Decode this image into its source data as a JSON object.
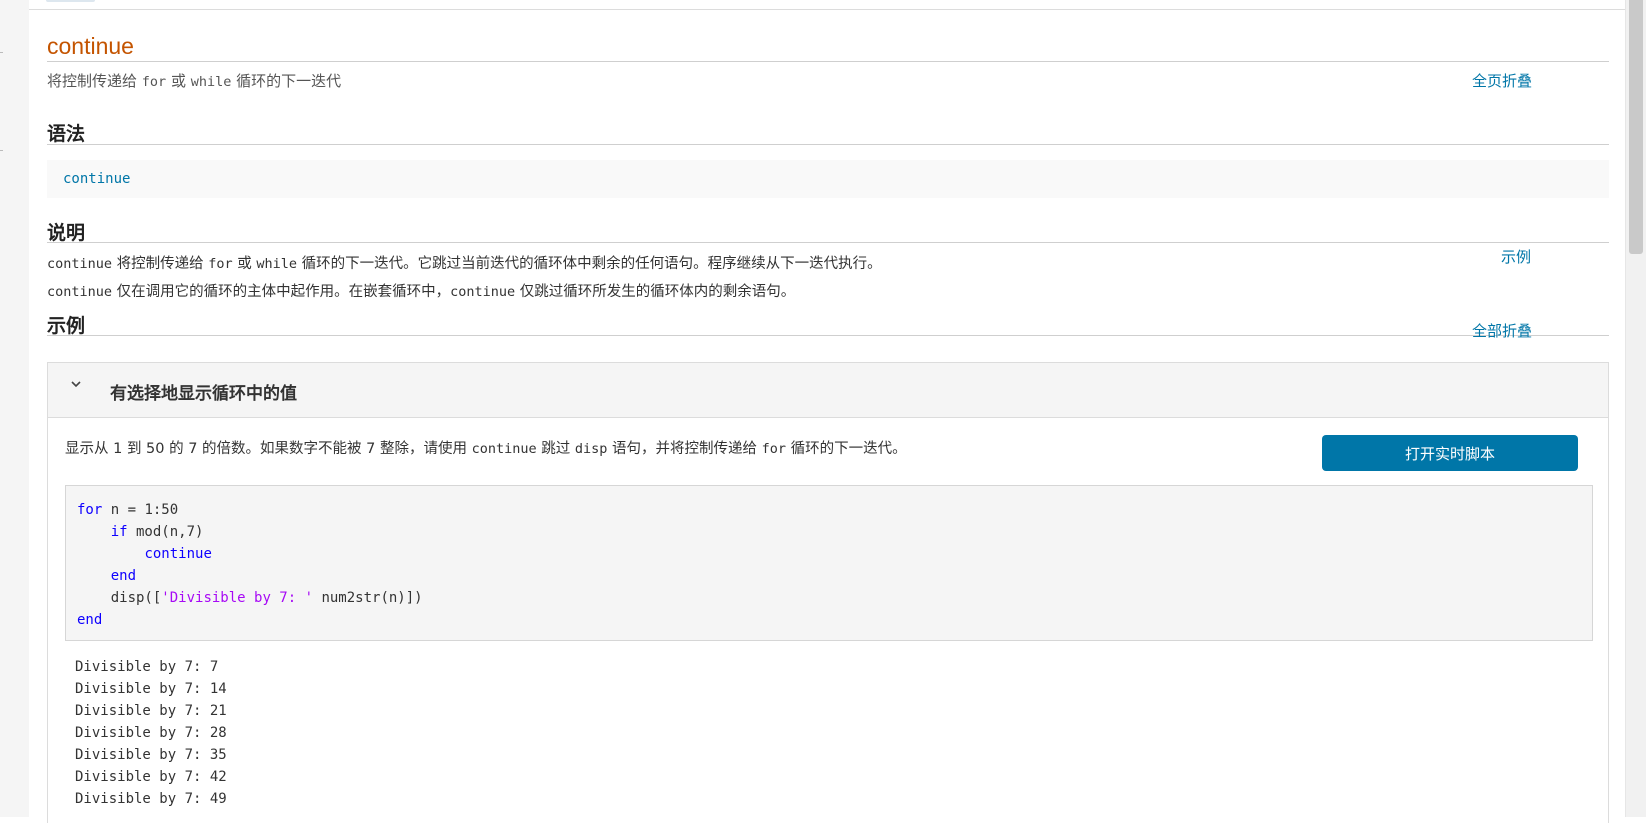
{
  "page": {
    "title": "continue",
    "subtitle_prefix": "将控制传递给 ",
    "subtitle_kw1": "for",
    "subtitle_mid": " 或 ",
    "subtitle_kw2": "while",
    "subtitle_suffix": " 循环的下一迭代",
    "collapse_page_link": "全页折叠"
  },
  "syntax": {
    "heading": "语法",
    "code": "continue"
  },
  "description": {
    "heading": "说明",
    "example_link": "示例",
    "line1": {
      "c1": "continue",
      "t1": " 将控制传递给 ",
      "c2": "for",
      "t2": " 或 ",
      "c3": "while",
      "t3": " 循环的下一迭代。它跳过当前迭代的循环体中剩余的任何语句。程序继续从下一迭代执行。"
    },
    "line2": {
      "c1": "continue",
      "t1": " 仅在调用它的循环的主体中起作用。在嵌套循环中，",
      "c2": "continue",
      "t2": " 仅跳过循环所发生的循环体内的剩余语句。"
    }
  },
  "examples": {
    "heading": "示例",
    "collapse_all_link": "全部折叠",
    "items": [
      {
        "title": "有选择地显示循环中的值",
        "desc": {
          "t1": "显示从 1 到 50 的 7 的倍数。如果数字不能被 7 整除，请使用 ",
          "c1": "continue",
          "t2": " 跳过 ",
          "c2": "disp",
          "t3": " 语句，并将控制传递给 ",
          "c3": "for",
          "t4": " 循环的下一迭代。"
        },
        "button_label": "打开实时脚本",
        "code": {
          "l1_kw": "for",
          "l1_rest": " n = 1:50",
          "l2_indent": "    ",
          "l2_kw": "if",
          "l2_rest": " mod(n,7)",
          "l3_indent": "        ",
          "l3_kw": "continue",
          "l4_indent": "    ",
          "l4_kw": "end",
          "l5_pre": "    disp([",
          "l5_str": "'Divisible by 7: '",
          "l5_post": " num2str(n)])",
          "l6_kw": "end"
        },
        "output": [
          "Divisible by 7: 7",
          "Divisible by 7: 14",
          "Divisible by 7: 21",
          "Divisible by 7: 28",
          "Divisible by 7: 35",
          "Divisible by 7: 42",
          "Divisible by 7: 49"
        ]
      }
    ]
  },
  "colors": {
    "title": "#c45400",
    "link": "#0076a8",
    "button": "#0076a8",
    "keyword": "#0e00ff",
    "string": "#a709f5"
  },
  "icons": {
    "chevron": "chevron-down-icon"
  }
}
